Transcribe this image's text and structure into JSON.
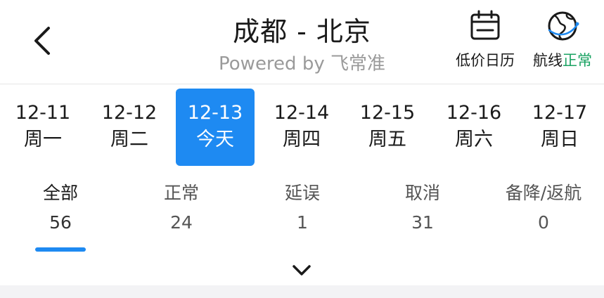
{
  "header": {
    "title": "成都 - 北京",
    "subtitle": "Powered by 飞常准",
    "calendar_label": "低价日历",
    "route_label_prefix": "航线",
    "route_label_status": "正常"
  },
  "dates": [
    {
      "date": "12-11",
      "weekday": "周一"
    },
    {
      "date": "12-12",
      "weekday": "周二"
    },
    {
      "date": "12-13",
      "weekday": "今天"
    },
    {
      "date": "12-14",
      "weekday": "周四"
    },
    {
      "date": "12-15",
      "weekday": "周五"
    },
    {
      "date": "12-16",
      "weekday": "周六"
    },
    {
      "date": "12-17",
      "weekday": "周日"
    }
  ],
  "stats": [
    {
      "label": "全部",
      "value": "56"
    },
    {
      "label": "正常",
      "value": "24"
    },
    {
      "label": "延误",
      "value": "1"
    },
    {
      "label": "取消",
      "value": "31"
    },
    {
      "label": "备降/返航",
      "value": "0"
    }
  ],
  "icons": {
    "back": "chevron-left-icon",
    "calendar": "calendar-icon",
    "route": "globe-icon",
    "expand": "chevron-down-icon"
  },
  "colors": {
    "accent": "#1e8af2",
    "ok_green": "#1aa262"
  }
}
